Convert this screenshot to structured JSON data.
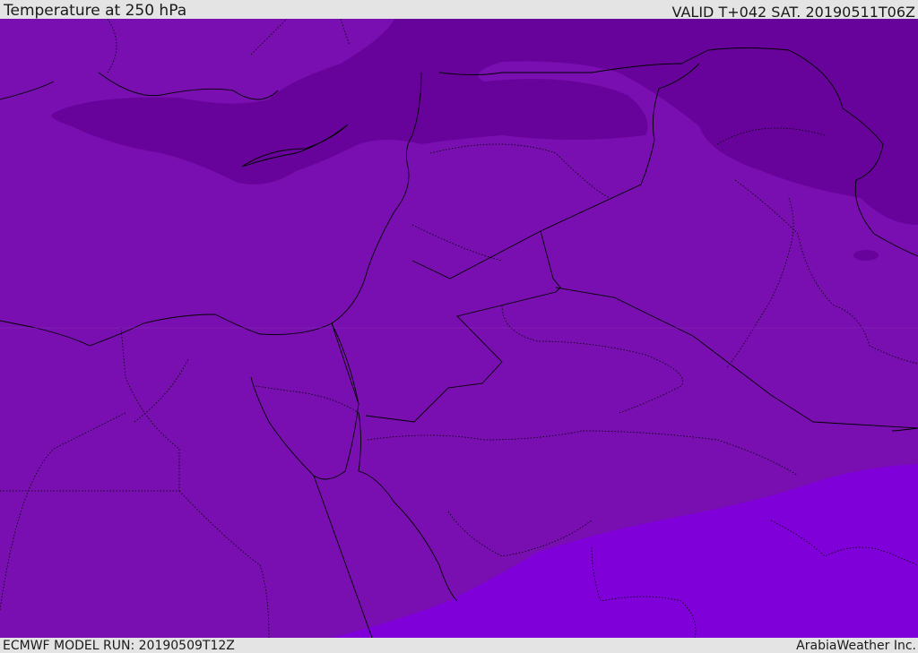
{
  "header": {
    "title": "Temperature at 250 hPa",
    "valid": "VALID T+042 SAT. 20190511T06Z"
  },
  "footer": {
    "model_run": "ECMWF MODEL RUN: 20190509T12Z",
    "credit": "ArabiaWeather Inc."
  },
  "colors": {
    "base": "#790fb0",
    "cold": "#67039a",
    "warm": "#7f00d8",
    "border": "#000000"
  }
}
